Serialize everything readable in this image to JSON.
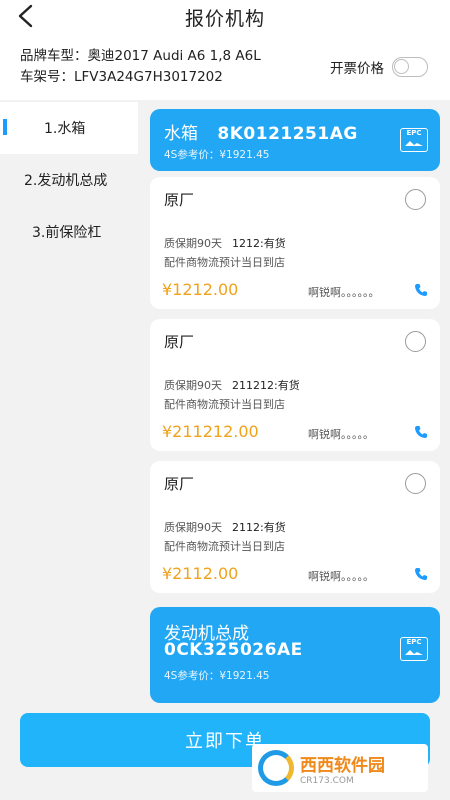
{
  "header": {
    "title": "报价机构"
  },
  "vehicle": {
    "model_line": "品牌车型：奥迪2017 Audi A6 1,8 A6L",
    "vin_line": "车架号：LFV3A24G7H3017202"
  },
  "invoice": {
    "label": "开票价格",
    "enabled": false
  },
  "sidebar": {
    "items": [
      {
        "label": "1.水箱",
        "active": true
      },
      {
        "label": "2.发动机总成",
        "active": false
      },
      {
        "label": "3.前保险杠",
        "active": false
      }
    ]
  },
  "parts": [
    {
      "name": "水箱",
      "code": "8K0121251AG",
      "ref_price": "4S参考价：¥1921.45",
      "epc": "EPC",
      "offers": [
        {
          "name": "原厂",
          "warranty": "质保期90天",
          "stock": "1212:有货",
          "delivery": "配件商物流预计当日到店",
          "price": "¥1212.00",
          "supplier": "啊锐啊。。。。。。"
        },
        {
          "name": "原厂",
          "warranty": "质保期90天",
          "stock": "211212:有货",
          "delivery": "配件商物流预计当日到店",
          "price": "¥211212.00",
          "supplier": "啊锐啊。。。。。"
        },
        {
          "name": "原厂",
          "warranty": "质保期90天",
          "stock": "2112:有货",
          "delivery": "配件商物流预计当日到店",
          "price": "¥2112.00",
          "supplier": "啊锐啊。。。。。"
        }
      ]
    },
    {
      "name": "发动机总成",
      "code": "0CK325026AE",
      "ref_price": "4S参考价：¥1921.45",
      "epc": "EPC"
    }
  ],
  "actions": {
    "order_label": "立即下单"
  },
  "watermark": {
    "logo_text": "西西软件园",
    "domain_text": "CR173.COM"
  },
  "colors": {
    "accent": "#22a7f4",
    "button": "#22b4fb",
    "price": "#f0a21c"
  }
}
